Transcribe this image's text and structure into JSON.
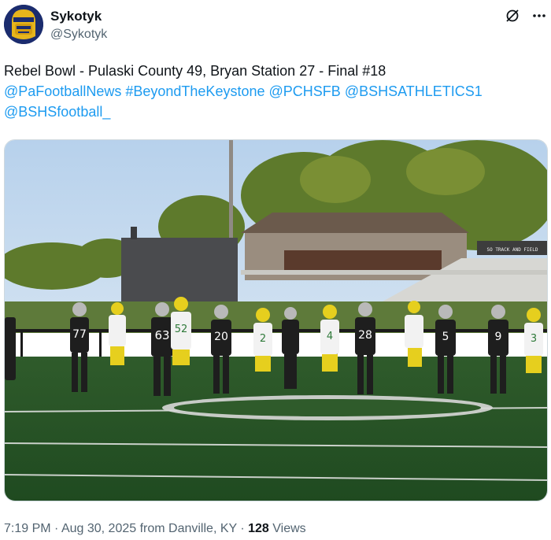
{
  "author": {
    "display_name": "Sykotyk",
    "handle": "@Sykotyk",
    "avatar_icon": "helmeted-face-avatar-icon"
  },
  "header_icons": [
    "grok-icon",
    "more-options-icon"
  ],
  "tweet": {
    "line1": "Rebel Bowl - Pulaski County 49, Bryan Station 27 - Final #18",
    "mentions": [
      "@PaFootballNews",
      "#BeyondTheKeystone",
      "@PCHSFB",
      "@BSHSATHLETICS1",
      "@BSHSfootball_"
    ]
  },
  "photo": {
    "description_icon": "football-field-photo",
    "scoreboard_text": "SO TRACK AND FIELD",
    "jerseys": [
      "77",
      "63",
      "52",
      "20",
      "2",
      "4",
      "28",
      "5",
      "9",
      "3"
    ]
  },
  "meta": {
    "time": "7:19 PM",
    "sep1": " · ",
    "date": "Aug 30, 2025 from Danville, KY",
    "sep2": " · ",
    "views_count": "128",
    "views_label": " Views"
  },
  "colors": {
    "link": "#1d9bf0",
    "secondary": "#536471",
    "primary": "#0f1419"
  }
}
